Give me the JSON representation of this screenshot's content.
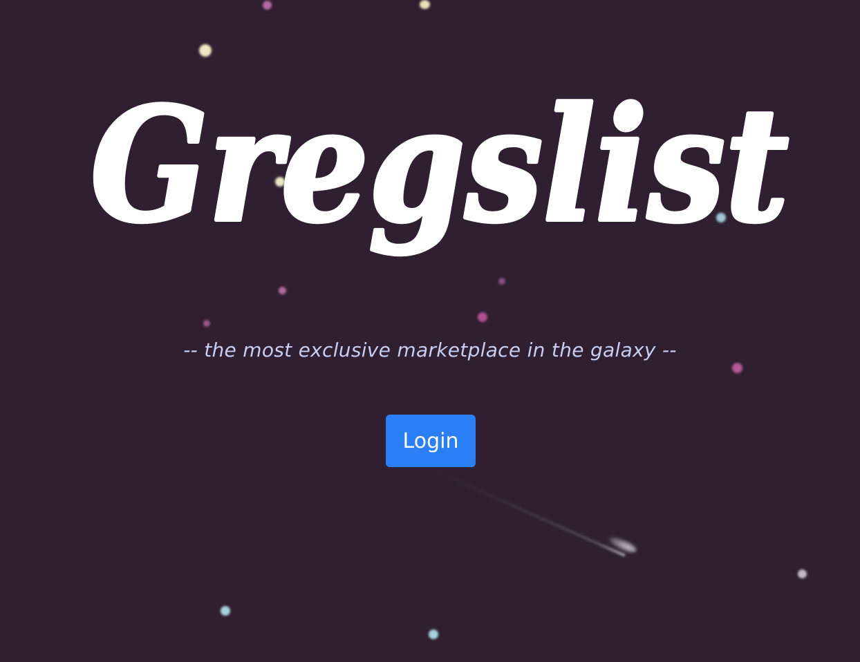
{
  "brand": {
    "name": "Gregslist",
    "tagline": "-- the most exclusive marketplace in the galaxy --"
  },
  "actions": {
    "login_label": "Login"
  },
  "colors": {
    "background": "#2f1f30",
    "brand_text": "#ffffff",
    "tagline_text": "#c9cdf0",
    "button_bg": "#2a7ff5",
    "button_text": "#ffffff"
  }
}
